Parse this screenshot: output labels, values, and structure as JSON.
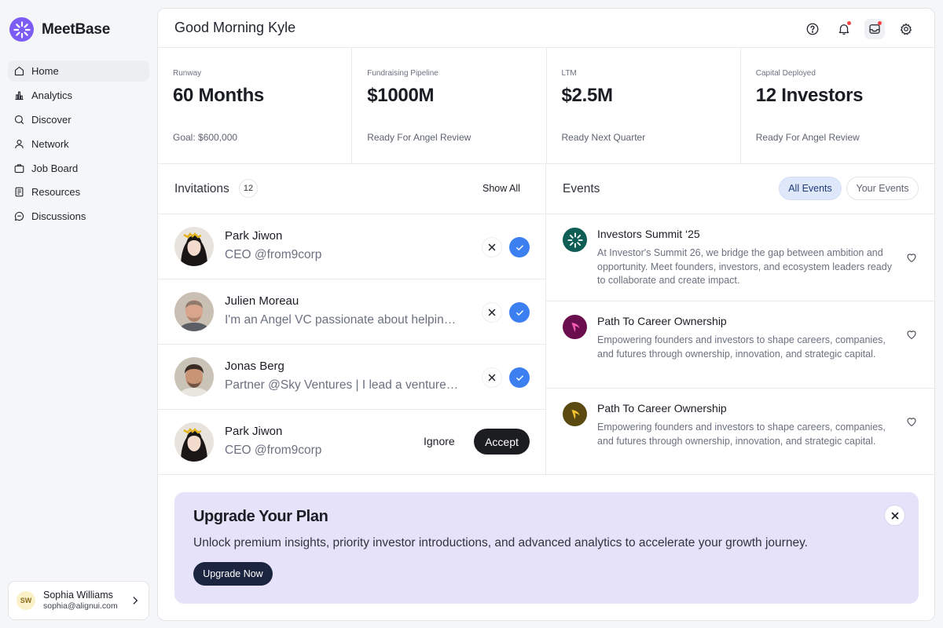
{
  "brand": {
    "name": "MeetBase",
    "logo_icon": "sunburst-logo-icon",
    "accent": "#7c5cf5"
  },
  "sidebar": {
    "items": [
      {
        "label": "Home",
        "icon": "home-icon",
        "active": true
      },
      {
        "label": "Analytics",
        "icon": "bar-chart-icon",
        "active": false
      },
      {
        "label": "Discover",
        "icon": "search-icon",
        "active": false
      },
      {
        "label": "Network",
        "icon": "user-icon",
        "active": false
      },
      {
        "label": "Job Board",
        "icon": "briefcase-icon",
        "active": false
      },
      {
        "label": "Resources",
        "icon": "book-icon",
        "active": false
      },
      {
        "label": "Discussions",
        "icon": "chat-icon",
        "active": false
      }
    ],
    "user": {
      "initials": "SW",
      "name": "Sophia Williams",
      "email": "sophia@alignui.com"
    }
  },
  "header": {
    "greeting": "Good Morning Kyle",
    "icons": [
      "help-icon",
      "bell-icon",
      "inbox-icon",
      "gear-icon"
    ]
  },
  "stats": [
    {
      "label": "Runway",
      "value": "60 Months",
      "sub": "Goal: $600,000"
    },
    {
      "label": "Fundraising Pipeline",
      "value": "$1000M",
      "sub": "Ready For Angel Review"
    },
    {
      "label": "LTM",
      "value": "$2.5M",
      "sub": "Ready Next Quarter"
    },
    {
      "label": "Capital Deployed",
      "value": "12 Investors",
      "sub": "Ready For Angel Review"
    }
  ],
  "invitations": {
    "title": "Invitations",
    "count": "12",
    "show_all": "Show All",
    "rows": [
      {
        "name": "Park Jiwon",
        "role": "CEO @from9corp"
      },
      {
        "name": "Julien Moreau",
        "role": "I'm an Angel VC passionate about helping startups grow"
      },
      {
        "name": "Jonas Berg",
        "role": "Partner @Sky Ventures | I lead a venture team"
      },
      {
        "name": "Park Jiwon",
        "role": "CEO @from9corp",
        "ignore_label": "Ignore",
        "accept_label": "Accept"
      }
    ]
  },
  "events": {
    "title": "Events",
    "tab_all": "All Events",
    "tab_yours": "Your Events",
    "rows": [
      {
        "title": "Investors Summit ‘25",
        "desc": "At Investor's Summit 26, we bridge the gap between ambition and opportunity. Meet founders, investors, and ecosystem leaders ready to collaborate and create impact.",
        "color": "#0f5e55"
      },
      {
        "title": "Path To Career Ownership",
        "desc": "Empowering founders and investors to shape careers, companies, and futures through ownership, innovation, and strategic capital.",
        "color": "#6b0e4d"
      },
      {
        "title": "Path To Career Ownership",
        "desc": "Empowering founders and investors to shape careers, companies, and futures through ownership, innovation, and strategic capital.",
        "color": "#5a4a12"
      }
    ]
  },
  "upgrade": {
    "title": "Upgrade Your Plan",
    "text": "Unlock premium insights, priority investor introductions, and advanced analytics to accelerate your growth journey.",
    "button": "Upgrade Now"
  }
}
